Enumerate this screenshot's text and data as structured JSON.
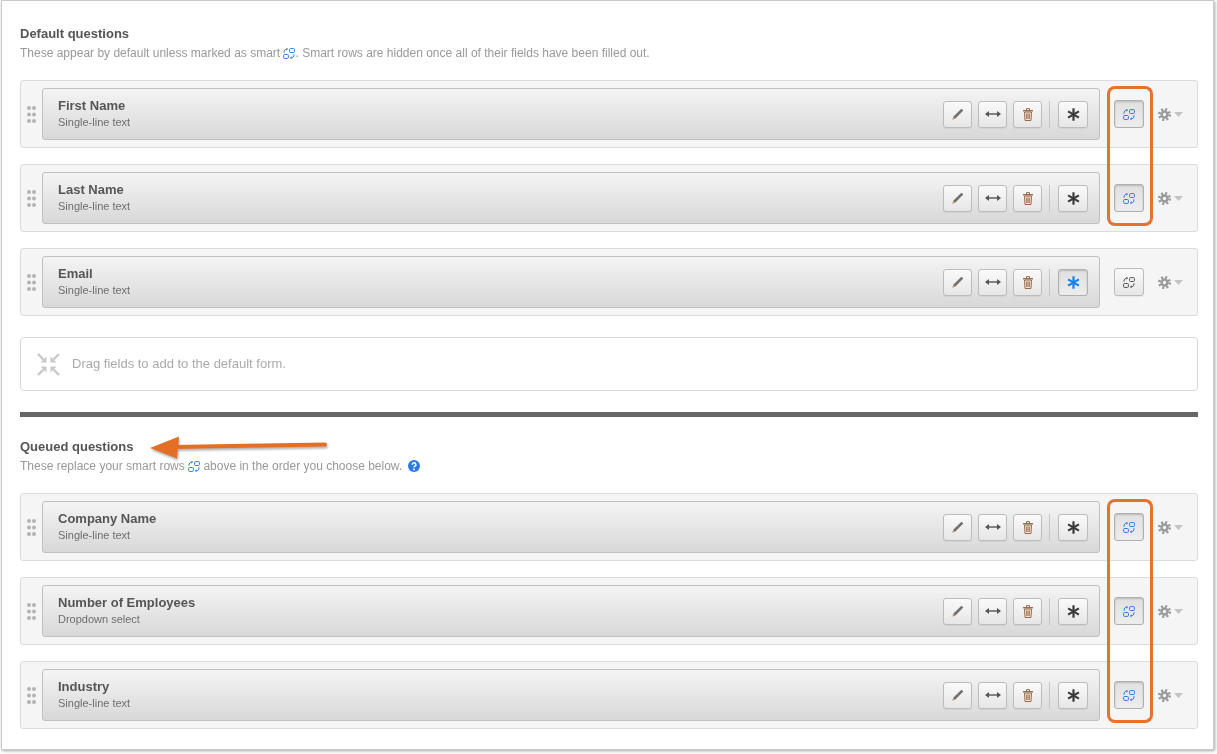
{
  "sections": [
    {
      "title": "Default questions",
      "description": [
        "These appear by default unless marked as smart ",
        ". Smart rows are hidden once all of their fields have been filled out."
      ],
      "rows": [
        {
          "label": "First Name",
          "type": "Single-line text",
          "required": false,
          "smart": true,
          "highlighted": true
        },
        {
          "label": "Last Name",
          "type": "Single-line text",
          "required": false,
          "smart": true,
          "highlighted": true
        },
        {
          "label": "Email",
          "type": "Single-line text",
          "required": true,
          "smart": false,
          "highlighted": false
        }
      ],
      "drop_zone": {
        "text": "Drag fields to add to the default form."
      }
    },
    {
      "title": "Queued questions",
      "callout_arrow": true,
      "description": [
        "These replace your smart rows ",
        " above in the order you choose below."
      ],
      "help_icon": true,
      "rows": [
        {
          "label": "Company Name",
          "type": "Single-line text",
          "required": false,
          "smart": true,
          "highlighted": true
        },
        {
          "label": "Number of Employees",
          "type": "Dropdown select",
          "required": false,
          "smart": true,
          "highlighted": true
        },
        {
          "label": "Industry",
          "type": "Single-line text",
          "required": false,
          "smart": true,
          "highlighted": true
        }
      ]
    }
  ]
}
